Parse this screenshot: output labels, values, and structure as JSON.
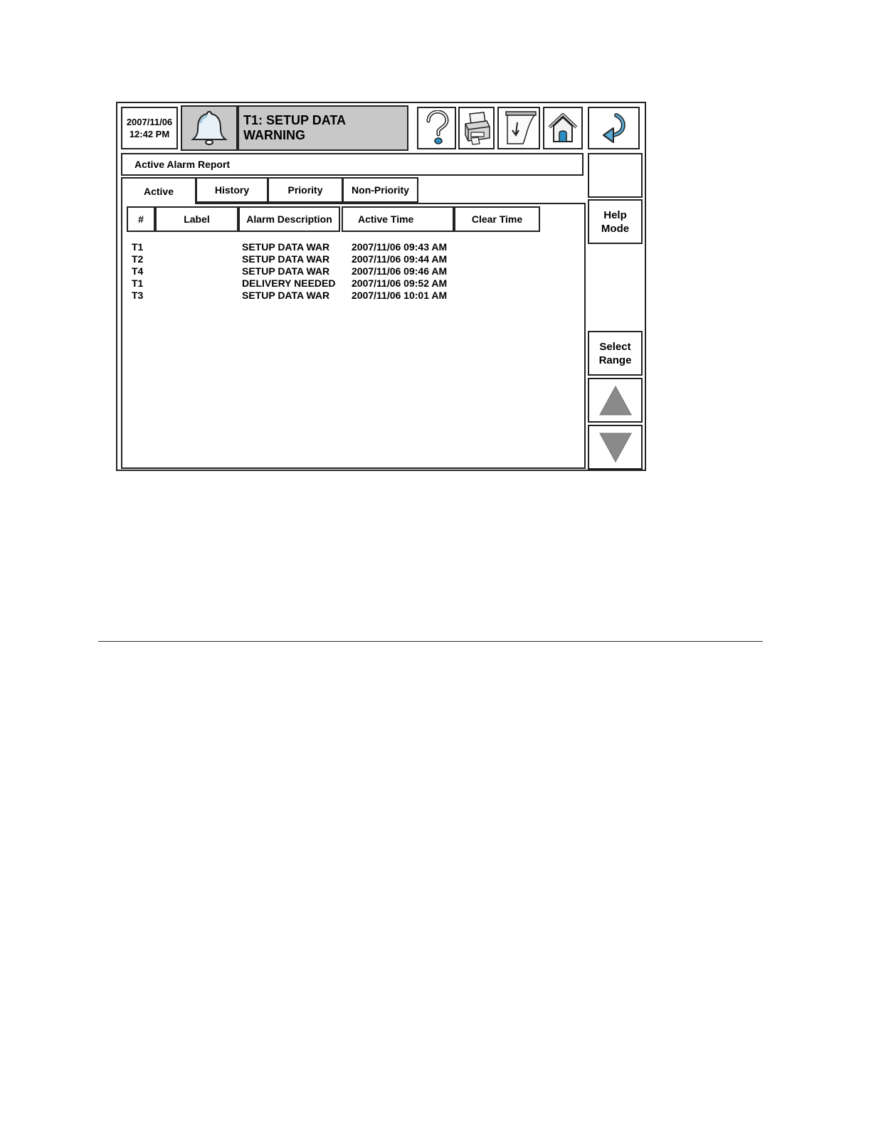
{
  "header": {
    "date": "2007/11/06",
    "time": "12:42 PM",
    "alarm_banner": "T1: SETUP DATA WARNING"
  },
  "icons": {
    "alarm": "bell-icon",
    "help": "question-mark-icon",
    "print": "printer-icon",
    "report_paper": "paper-feed-icon",
    "home": "home-icon",
    "back": "back-arrow-icon",
    "scroll_up": "triangle-up-icon",
    "scroll_down": "triangle-down-icon"
  },
  "report": {
    "title": "Active Alarm Report",
    "tabs": [
      "Active",
      "History",
      "Priority",
      "Non-Priority"
    ],
    "columns": [
      "#",
      "Label",
      "Alarm Description",
      "Active Time",
      "Clear Time"
    ],
    "rows": [
      {
        "num": "T1",
        "label": "",
        "description": "SETUP DATA WAR",
        "active_time": "2007/11/06 09:43 AM",
        "clear_time": ""
      },
      {
        "num": "T2",
        "label": "",
        "description": "SETUP DATA WAR",
        "active_time": "2007/11/06 09:44 AM",
        "clear_time": ""
      },
      {
        "num": "T4",
        "label": "",
        "description": "SETUP DATA WAR",
        "active_time": "2007/11/06 09:46 AM",
        "clear_time": ""
      },
      {
        "num": "T1",
        "label": "",
        "description": "DELIVERY NEEDED",
        "active_time": "2007/11/06 09:52 AM",
        "clear_time": ""
      },
      {
        "num": "T3",
        "label": "",
        "description": "SETUP DATA WAR",
        "active_time": "2007/11/06 10:01 AM",
        "clear_time": ""
      }
    ]
  },
  "sidebar": {
    "help_mode_line1": "Help",
    "help_mode_line2": "Mode",
    "select_range_line1": "Select",
    "select_range_line2": "Range"
  },
  "colors": {
    "banner_gray": "#c8c8c8",
    "border": "#222222",
    "icon_blue": "#2a8fc4"
  }
}
